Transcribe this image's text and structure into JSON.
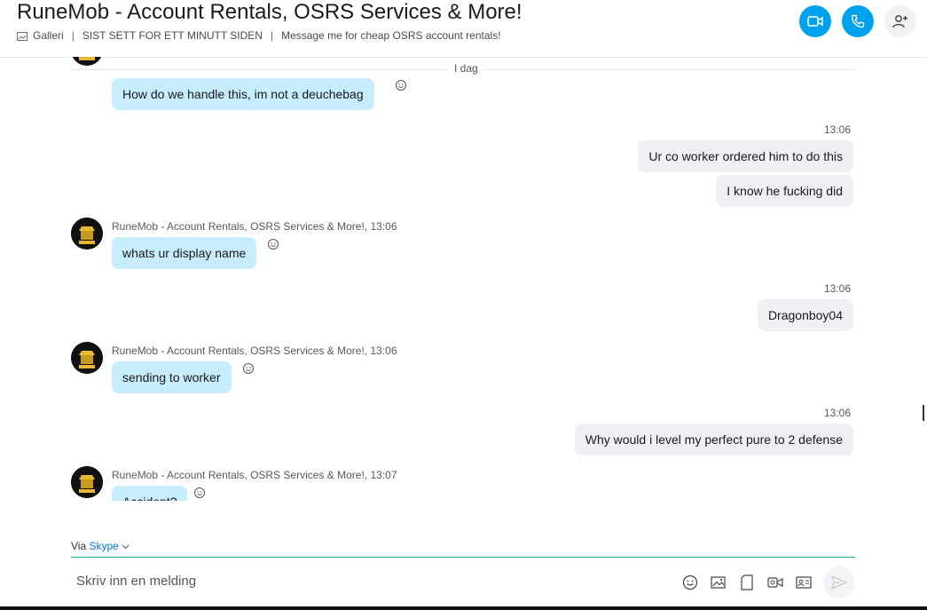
{
  "header": {
    "title": "RuneMob - Account Rentals, OSRS Services & More!",
    "gallery": "Galleri",
    "last_seen": "SIST SETT FOR ETT MINUTT SIDEN",
    "mood": "Message me for cheap OSRS account rentals!",
    "sep": "|"
  },
  "divider": {
    "label": "I dag"
  },
  "messages": {
    "m1_text": "How do we handle this, im not a deuchebag",
    "out1_time": "13:06",
    "out1a_text": "Ur co worker ordered him to do this",
    "out1b_text": "I know he fucking did",
    "m2_sender": "RuneMob - Account Rentals, OSRS Services & More!,",
    "m2_time": "13:06",
    "m2_text": "whats ur display name",
    "out2_time": "13:06",
    "out2_text": "Dragonboy04",
    "m3_sender": "RuneMob - Account Rentals, OSRS Services & More!,",
    "m3_time": "13:06",
    "m3_text": "sending to worker",
    "out3_time": "13:06",
    "out3_text": "Why would i level my perfect pure to 2 defense",
    "m4_sender": "RuneMob - Account Rentals, OSRS Services & More!,",
    "m4_time": "13:07",
    "m4_text": "Accident?"
  },
  "footer": {
    "via_label": "Via",
    "via_service": "Skype",
    "compose_placeholder": "Skriv inn en melding"
  },
  "colors": {
    "accent": "#00a2ed",
    "incoming_bubble": "#c7edfc",
    "outgoing_bubble": "#eef0f4",
    "compose_underline": "#2a9fa0"
  },
  "icons": [
    "gallery-icon",
    "video-call-icon",
    "audio-call-icon",
    "add-person-icon",
    "emoji-icon",
    "image-icon",
    "file-icon",
    "video-message-icon",
    "contact-card-icon",
    "send-icon",
    "reaction-icon"
  ]
}
